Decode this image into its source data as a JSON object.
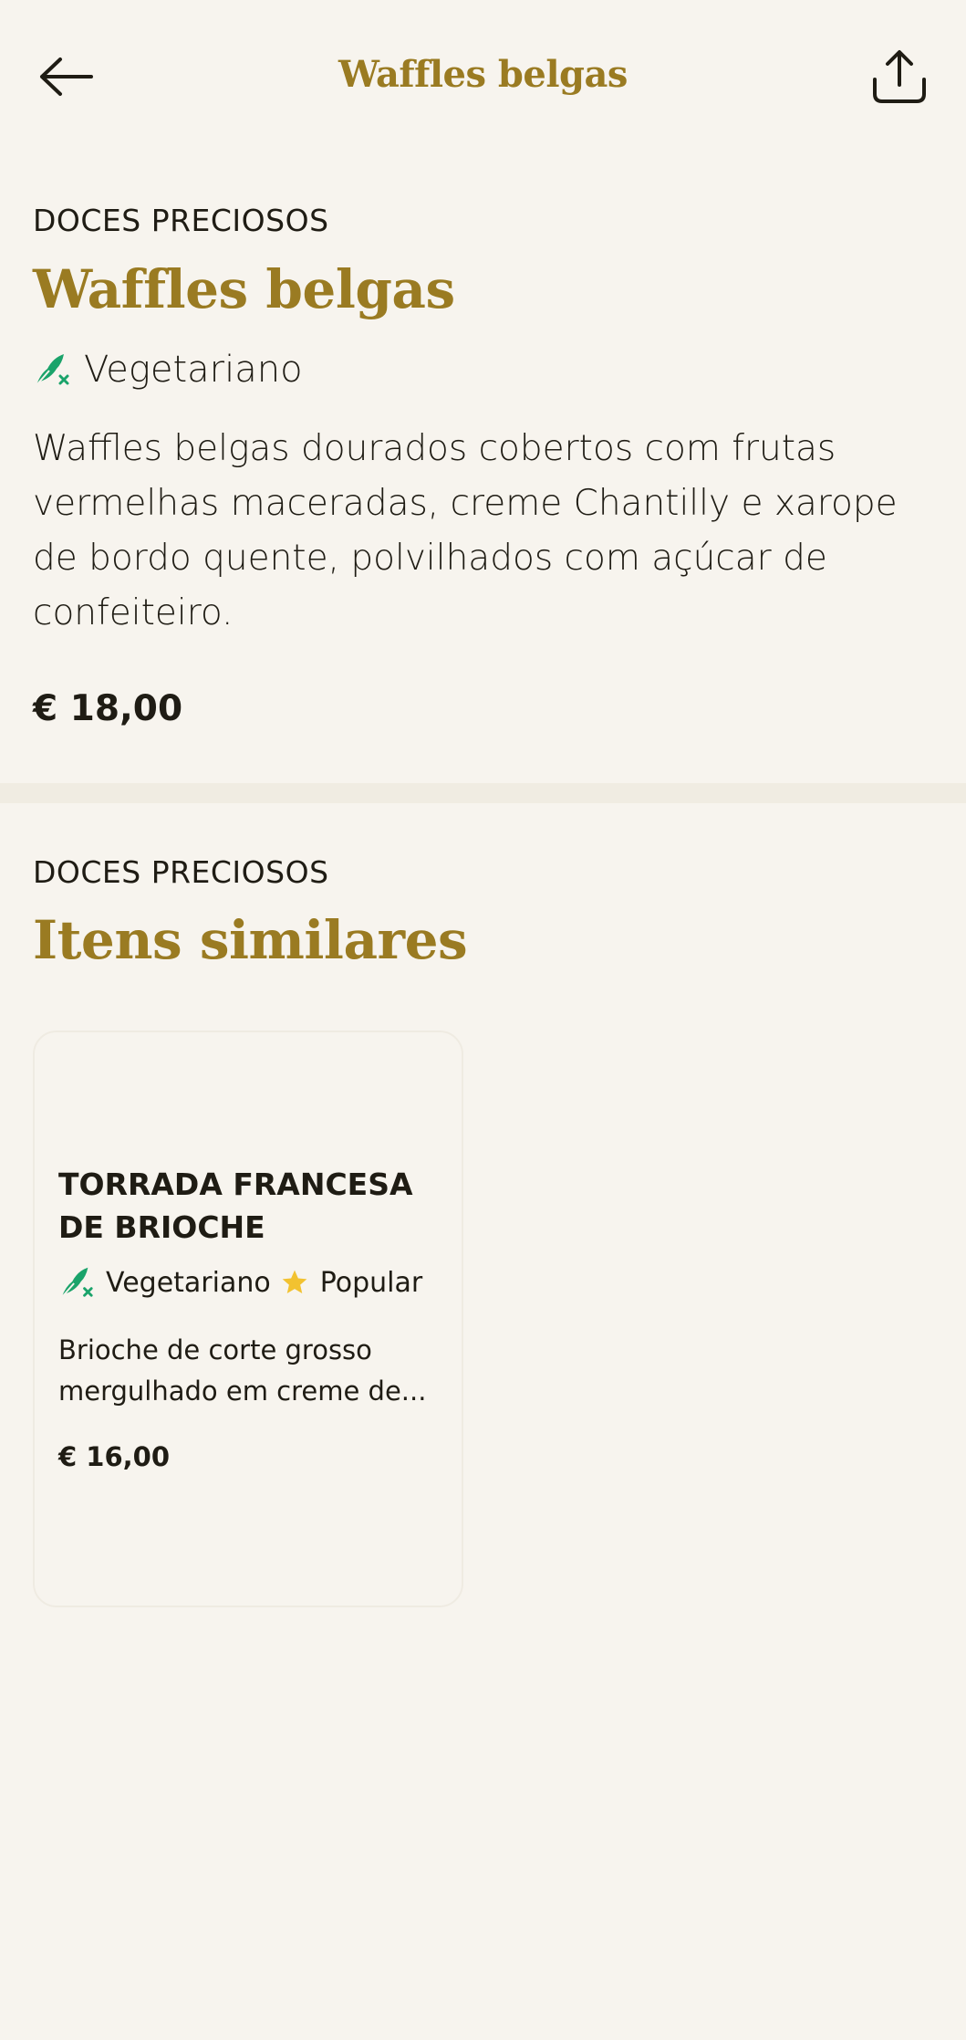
{
  "header": {
    "title": "Waffles belgas"
  },
  "item": {
    "category": "DOCES PRECIOSOS",
    "name": "Waffles belgas",
    "diet_tag": "Vegetariano",
    "description": "Waffles belgas dourados cobertos com frutas vermelhas maceradas, creme Chantilly e xarope de bordo quente, polvilhados com açúcar de confeiteiro.",
    "price": "€ 18,00"
  },
  "similar": {
    "category": "DOCES PRECIOSOS",
    "heading": "Itens similares",
    "items": [
      {
        "title": "TORRADA FRANCESA DE BRIOCHE",
        "diet_tag": "Vegetariano",
        "popular_tag": "Popular",
        "description": "Brioche de corte grosso mergulhado em creme de...",
        "price": "€ 16,00"
      }
    ]
  },
  "colors": {
    "background": "#f7f4ee",
    "accent_gold": "#9a7b22",
    "veg_green": "#1aa36a",
    "star_yellow": "#f2c230",
    "text": "#1f1c14"
  },
  "icons": {
    "back": "arrow-left-icon",
    "share": "share-icon",
    "vegetarian": "leaf-icon",
    "popular": "star-icon"
  }
}
